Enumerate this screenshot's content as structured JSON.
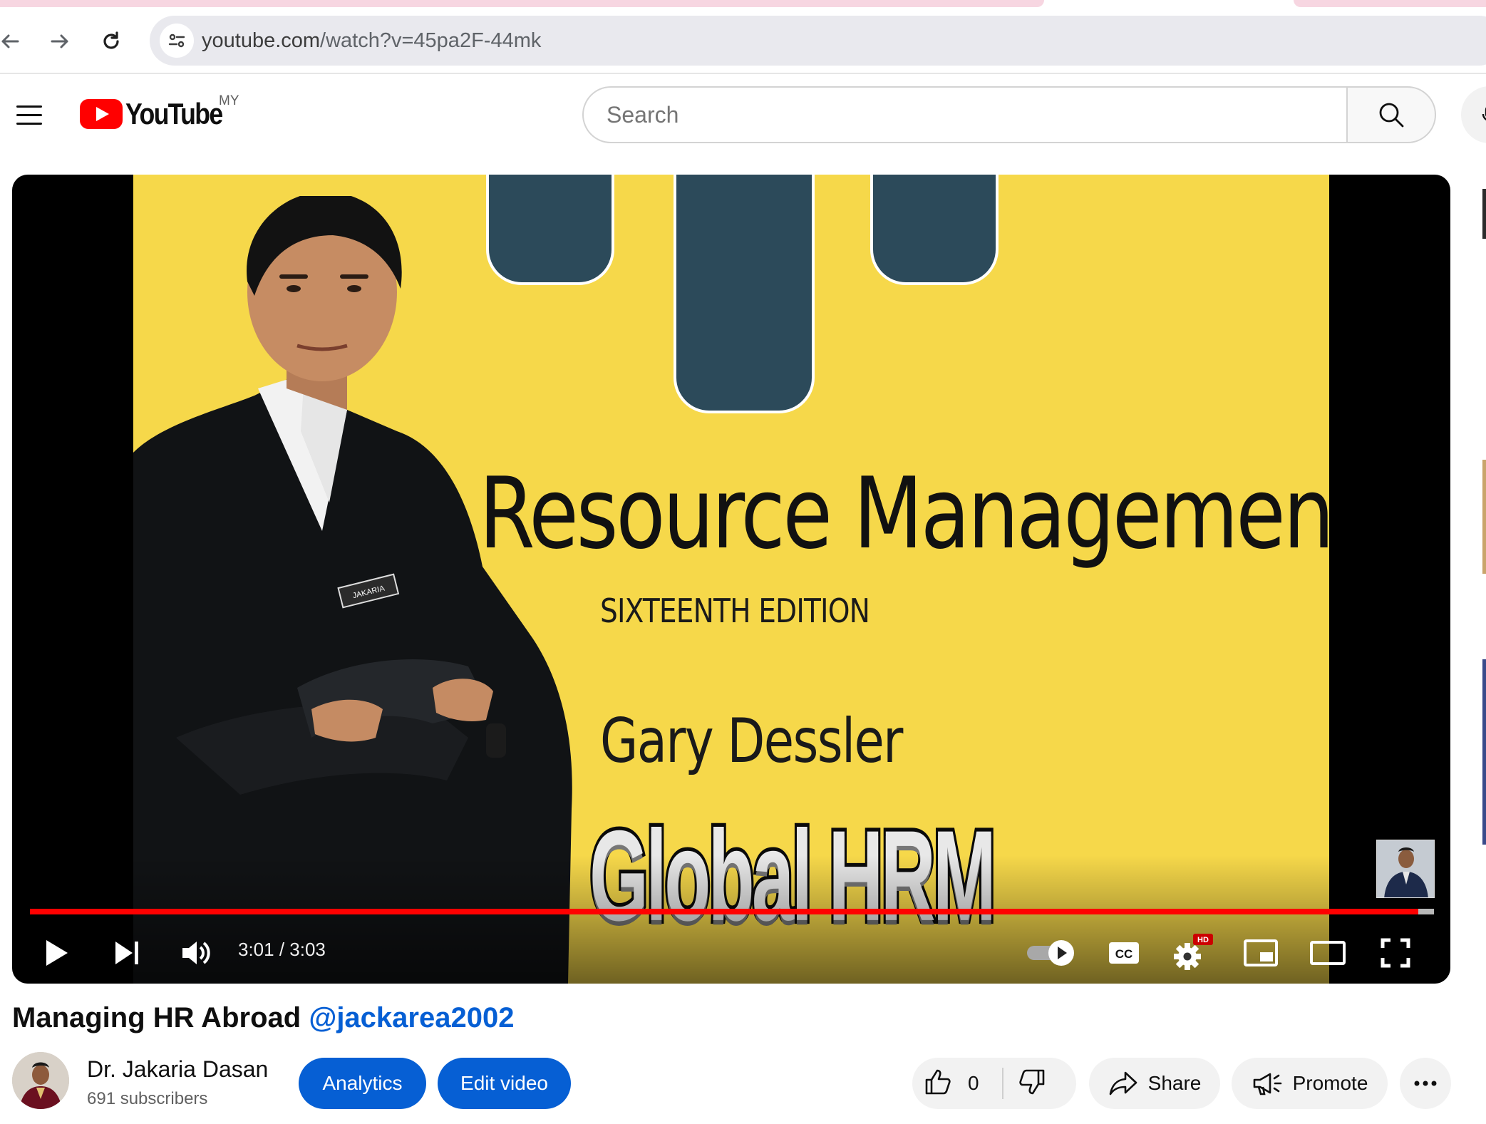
{
  "browser": {
    "url_host": "youtube.com",
    "url_path": "/watch?v=45pa2F-44mk"
  },
  "masthead": {
    "logo_text": "YouTube",
    "country_code": "MY",
    "search_placeholder": "Search"
  },
  "video": {
    "slide_title": "Resource Management",
    "slide_edition": "SIXTEENTH EDITION",
    "slide_author": "Gary Dessler",
    "badge_name": "JAKARIA",
    "overlay_title": "Global HRM",
    "current_time": "3:01",
    "duration": "3:03",
    "time_display": "3:01 / 3:03",
    "progress_fraction": 0.989,
    "settings_badge": "HD",
    "cc_label": "CC"
  },
  "details": {
    "title": "Managing HR Abroad",
    "handle": "@jackarea2002",
    "channel_name": "Dr. Jakaria Dasan",
    "subscribers": "691 subscribers",
    "analytics_label": "Analytics",
    "edit_label": "Edit video",
    "like_count": "0",
    "share_label": "Share",
    "promote_label": "Promote"
  },
  "colors": {
    "brand_red": "#ff0000",
    "link_blue": "#065fd4",
    "slide_yellow": "#f6d84a",
    "slide_teal": "#2c4a5a"
  }
}
